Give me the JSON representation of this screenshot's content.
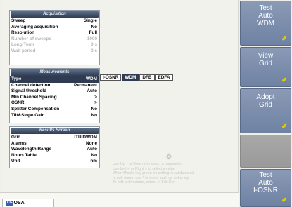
{
  "acquisition": {
    "title": "Acquisition",
    "rows": [
      {
        "label": "Sweep",
        "value": "Single",
        "dim": false
      },
      {
        "label": "Averaging acquisition",
        "value": "No",
        "dim": false
      },
      {
        "label": "Resolution",
        "value": "Full",
        "dim": false
      },
      {
        "label": "Number of sweeps",
        "value": "1000",
        "dim": true
      },
      {
        "label": "Long Term",
        "value": "0 s",
        "dim": true
      },
      {
        "label": "Wait period",
        "value": "0 s",
        "dim": true
      }
    ]
  },
  "measurements": {
    "title": "Measurements",
    "rows": [
      {
        "label": "Type",
        "value": "WDM",
        "selected": true
      },
      {
        "label": "Channel detection",
        "value": "Permanent"
      },
      {
        "label": "Signal threshold",
        "value": "Auto"
      },
      {
        "label": "Min.Channel Spacing",
        "value": ">"
      },
      {
        "label": "OSNR",
        "value": ">"
      },
      {
        "label": "Splitter Compensation",
        "value": "No"
      },
      {
        "label": "Tilt&Slope Gain",
        "value": "No"
      }
    ],
    "type_options": [
      "I-OSNR",
      "WDM",
      "DFB",
      "EDFA"
    ],
    "type_selected": "WDM"
  },
  "results_screen": {
    "title": "Results Screen",
    "rows": [
      {
        "label": "Grid",
        "value": "ITU DWDM"
      },
      {
        "label": "Alarms",
        "value": "None"
      },
      {
        "label": "Wavelength Range",
        "value": "Auto"
      },
      {
        "label": "Notes Table",
        "value": "No"
      },
      {
        "label": "Unit",
        "value": "nm"
      }
    ]
  },
  "help": {
    "lines": [
      "Use Up ^ or Down v to select a parameter",
      "Use Left < or Right > to select a value",
      "When Middle key green on setting: it validates sel",
      "In sub-menu, use ^ to move back up to the top",
      "To edit text/number, select -> Edit Key"
    ]
  },
  "sidebar": {
    "buttons": [
      {
        "label_lines": [
          "Test",
          "Auto",
          "WDM"
        ]
      },
      {
        "label_lines": [
          "View",
          "Grid"
        ]
      },
      {
        "label_lines": [
          "Adopt",
          "Grid"
        ]
      },
      {
        "label_lines": []
      },
      {
        "label_lines": [
          "Test",
          "Auto",
          "I-OSNR"
        ]
      }
    ],
    "mark_glyph": "✐"
  },
  "status_bar": {
    "tab_tag": "CG",
    "tab_label": "OSA"
  },
  "colors": {
    "accent": "#2e3b50",
    "side_button": "#7b8dac",
    "hint_text": "#c6c6c6"
  }
}
